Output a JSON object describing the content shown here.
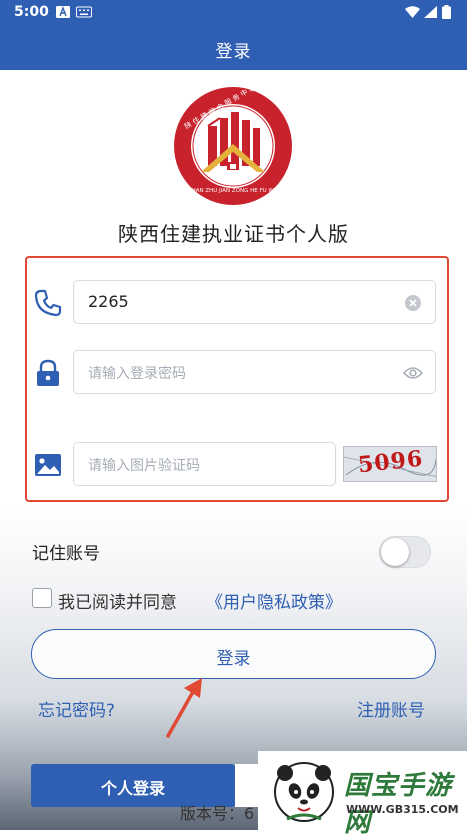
{
  "status_bar": {
    "time": "5:00"
  },
  "header": {
    "title": "登录"
  },
  "app": {
    "name": "陕西住建执业证书个人版"
  },
  "form": {
    "phone_value": "2265",
    "password_placeholder": "请输入登录密码",
    "captcha_placeholder": "请输入图片验证码",
    "captcha_text": "5096"
  },
  "options": {
    "remember_label": "记住账号",
    "remember_on": false,
    "agree_label": "我已阅读并同意",
    "agree_checked": false,
    "policy_link": "《用户隐私政策》"
  },
  "actions": {
    "login_label": "登录",
    "forgot_label": "忘记密码?",
    "register_label": "注册账号",
    "personal_login_label": "个人登录",
    "version_text": "版本号：6"
  },
  "watermark": {
    "name": "国宝手游网",
    "url": "WWW.GB315.COM"
  },
  "colors": {
    "primary": "#2f5fb3",
    "highlight": "#e04a33",
    "logo_red": "#c8232c",
    "logo_gold": "#e4b23c"
  },
  "icons": [
    "phone-icon",
    "lock-icon",
    "image-icon",
    "clear-icon",
    "eye-icon"
  ]
}
